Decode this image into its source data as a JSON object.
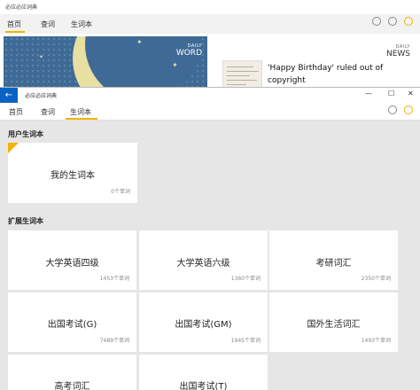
{
  "background_window": {
    "app_title": "必应必应词典",
    "tabs": [
      "首页",
      "查词",
      "生词本"
    ],
    "daily_word_small": "DAILY",
    "daily_word_big": "WORD",
    "daily_news_small": "DAILY",
    "daily_news_big": "NEWS",
    "news_headline": "'Happy Birthday' ruled out of copyright"
  },
  "window": {
    "app_title": "必应必应词典",
    "back_glyph": "←",
    "minimize_glyph": "—",
    "maximize_glyph": "☐",
    "close_glyph": "✕"
  },
  "tabs": {
    "home": "首页",
    "lookup": "查词",
    "vocab": "生词本",
    "active": "生词本",
    "accent_color": "#f2b400"
  },
  "user_section": {
    "title": "用户生词本",
    "books": [
      {
        "name": "我的生词本",
        "count": "0个单词"
      }
    ]
  },
  "extended_section": {
    "title": "扩展生词本",
    "books": [
      {
        "name": "大学英语四级",
        "count": "1453个单词"
      },
      {
        "name": "大学英语六级",
        "count": "1360个单词"
      },
      {
        "name": "考研词汇",
        "count": "2350个单词"
      },
      {
        "name": "出国考试(G)",
        "count": "7489个单词"
      },
      {
        "name": "出国考试(GM)",
        "count": "1945个单词"
      },
      {
        "name": "国外生活词汇",
        "count": "1493个单词"
      },
      {
        "name": "高考词汇",
        "count": ""
      },
      {
        "name": "出国考试(T)",
        "count": ""
      }
    ]
  }
}
